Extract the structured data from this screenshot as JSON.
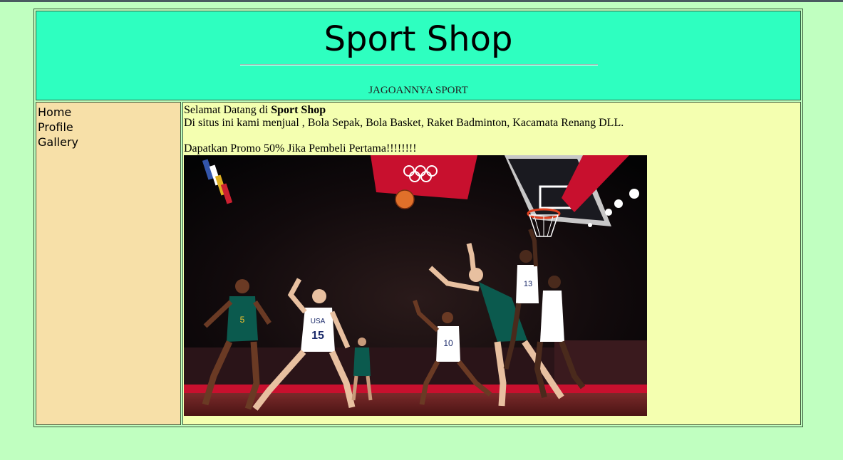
{
  "header": {
    "title": "Sport Shop",
    "tagline": "JAGOANNYA SPORT"
  },
  "sidebar": {
    "items": [
      {
        "label": "Home"
      },
      {
        "label": "Profile"
      },
      {
        "label": "Gallery"
      }
    ]
  },
  "main": {
    "welcome_prefix": "Selamat Datang di ",
    "welcome_brand": "Sport Shop",
    "description": "Di situs ini kami menjual , Bola Sepak, Bola Basket, Raket Badminton, Kacamata Renang DLL.",
    "promo": "Dapatkan Promo 50% Jika Pembeli Pertama!!!!!!!!",
    "photo": {
      "jersey_numbers": [
        "5",
        "15",
        "10",
        "13"
      ],
      "jersey_text": "USA"
    }
  },
  "colors": {
    "page_bg": "#c0ffc0",
    "header_bg": "#2effc0",
    "sidebar_bg": "#f7e0a8",
    "content_bg": "#f4ffb0"
  }
}
